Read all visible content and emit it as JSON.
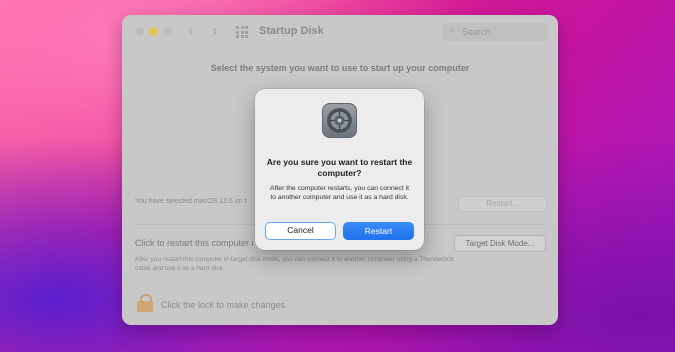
{
  "window": {
    "title": "Startup Disk",
    "search_placeholder": "Search",
    "select_header": "Select the system you want to use to start up your computer",
    "selected_text": "You have selected macOS 12.6 on t",
    "restart_label": "Restart...",
    "click_restart_label": "Click to restart this computer i",
    "target_disk_button": "Target Disk Mode...",
    "after_restart_text": "After you restart this computer in target disk mode, you can connect it to another computer using a Thunderbolt cable and use it as a hard disk.",
    "lock_text": "Click the lock to make changes."
  },
  "dialog": {
    "title": "Are you sure you want to restart the computer?",
    "message": "After the computer restarts, you can connect it to another computer and use it as a hard disk.",
    "cancel_label": "Cancel",
    "restart_label": "Restart"
  },
  "icons": {
    "app": "system-preferences-gear-icon",
    "lock": "lock-icon",
    "search": "search-icon"
  },
  "colors": {
    "accent": "#1f72ef",
    "focus_ring": "#6aa3f0"
  }
}
